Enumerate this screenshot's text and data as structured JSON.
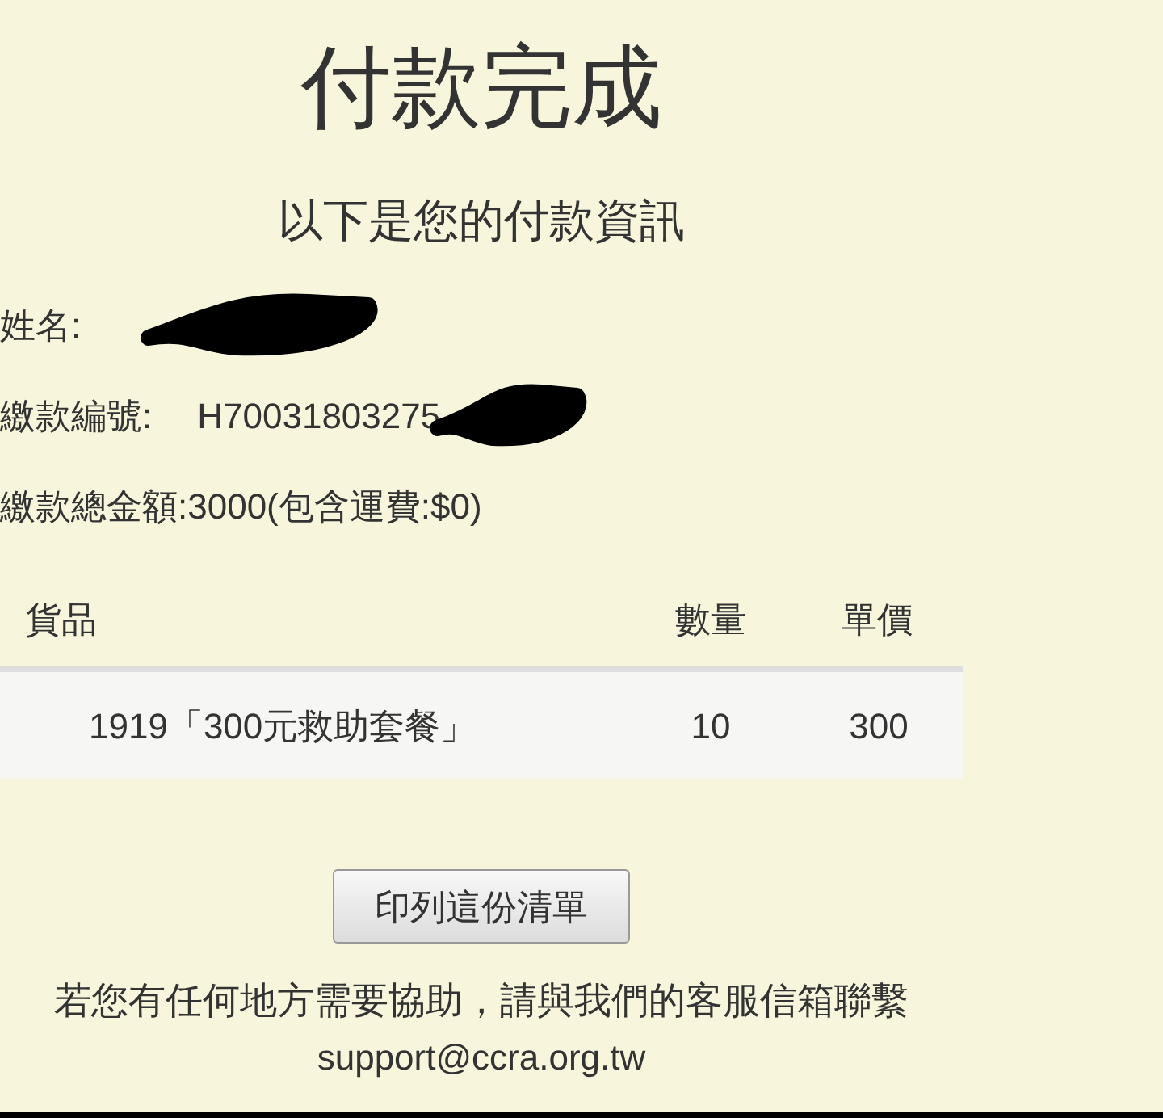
{
  "title": "付款完成",
  "subtitle": "以下是您的付款資訊",
  "fields": [
    {
      "label": "姓名:",
      "redacted": true
    },
    {
      "label": "繳款編號:",
      "value": "H70031803275",
      "redacted": true
    },
    {
      "label": "繳款總金額:3000(包含運費:$0)",
      "redacted": false
    }
  ],
  "table": {
    "columns": [
      "貨品",
      "數量",
      "單價"
    ],
    "rows": [
      [
        "1919「300元救助套餐」",
        "10",
        "300"
      ]
    ]
  },
  "print_button": "印列這份清單",
  "help_text": "若您有任何地方需要協助，請與我們的客服信箱聯繫",
  "email": "support@ccra.org.tw"
}
